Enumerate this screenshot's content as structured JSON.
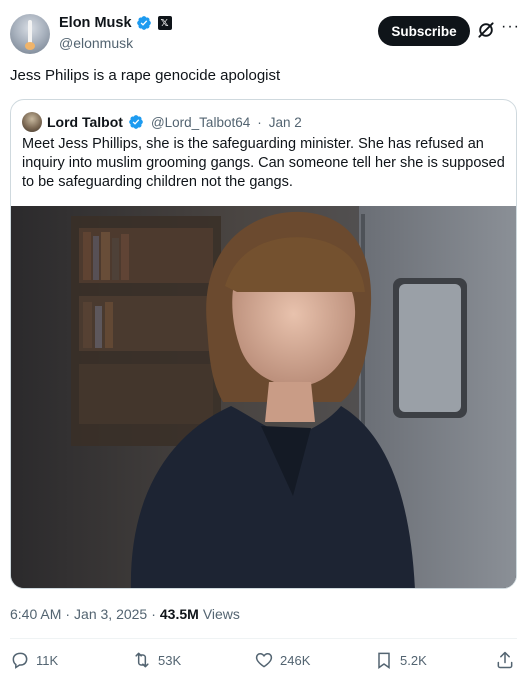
{
  "author": {
    "display_name": "Elon Musk",
    "handle": "@elonmusk",
    "verified_icon": "verified-badge-icon",
    "affiliation_icon": "x-logo-icon",
    "affiliation_label": "𝕏"
  },
  "header": {
    "subscribe_label": "Subscribe",
    "grok_icon": "grok-icon",
    "more_label": "···"
  },
  "tweet": {
    "text": "Jess Philips is a rape genocide apologist"
  },
  "quoted": {
    "display_name": "Lord Talbot",
    "handle": "@Lord_Talbot64",
    "separator": "·",
    "date": "Jan 2",
    "text": "Meet Jess Phillips, she is the safeguarding minister. She has refused an inquiry into muslim grooming gangs. Can someone tell her she is supposed to be safeguarding children not the gangs."
  },
  "meta": {
    "time": "6:40 AM",
    "sep1": "·",
    "date": "Jan 3, 2025",
    "sep2": "·",
    "views_count": "43.5M",
    "views_label": "Views"
  },
  "actions": {
    "replies": "11K",
    "reposts": "53K",
    "likes": "246K",
    "bookmarks": "5.2K"
  },
  "colors": {
    "text": "#0f1419",
    "secondary": "#536471",
    "border": "#cfd9de",
    "verified": "#1d9bf0"
  }
}
